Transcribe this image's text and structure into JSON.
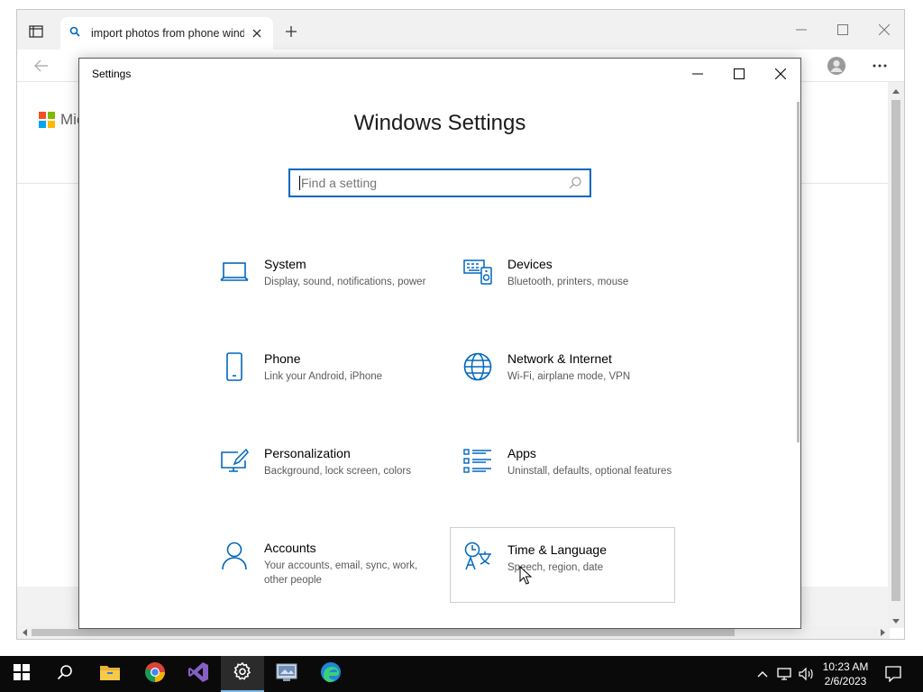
{
  "browser": {
    "tab_title": "import photos from phone windows",
    "logo_text": "Microsoft"
  },
  "settings": {
    "window_title": "Settings",
    "heading": "Windows Settings",
    "search_placeholder": "Find a setting",
    "categories": [
      {
        "name": "System",
        "description": "Display, sound, notifications, power",
        "icon": "laptop-icon"
      },
      {
        "name": "Devices",
        "description": "Bluetooth, printers, mouse",
        "icon": "keyboard-speaker-icon"
      },
      {
        "name": "Phone",
        "description": "Link your Android, iPhone",
        "icon": "phone-icon"
      },
      {
        "name": "Network & Internet",
        "description": "Wi-Fi, airplane mode, VPN",
        "icon": "globe-icon"
      },
      {
        "name": "Personalization",
        "description": "Background, lock screen, colors",
        "icon": "paint-monitor-icon"
      },
      {
        "name": "Apps",
        "description": "Uninstall, defaults, optional features",
        "icon": "apps-list-icon"
      },
      {
        "name": "Accounts",
        "description": "Your accounts, email, sync, work, other people",
        "icon": "person-icon"
      },
      {
        "name": "Time & Language",
        "description": "Speech, region, date",
        "icon": "time-language-icon"
      }
    ],
    "accent_color": "#0067c0"
  },
  "taskbar": {
    "apps": [
      "start-icon",
      "search-icon",
      "file-explorer-icon",
      "chrome-icon",
      "visual-studio-icon",
      "settings-gear-icon",
      "control-panel-icon",
      "edge-icon"
    ],
    "clock_time": "10:23 AM",
    "clock_date": "2/6/2023"
  }
}
